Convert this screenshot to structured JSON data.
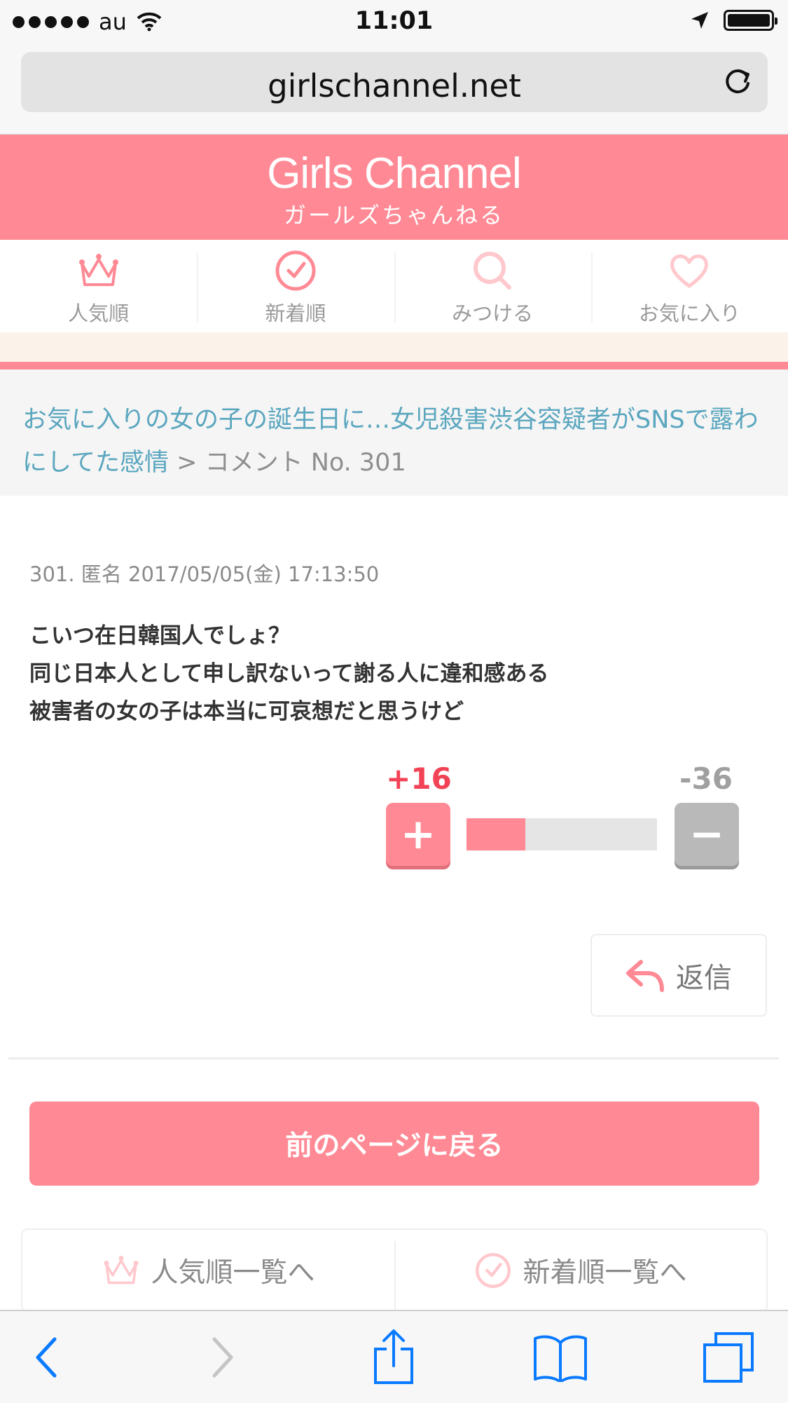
{
  "status_bar": {
    "carrier": "au",
    "time": "11:01"
  },
  "browser": {
    "url": "girlschannel.net"
  },
  "header": {
    "title_en": "Girls Channel",
    "title_jp": "ガールズちゃんねる"
  },
  "nav": {
    "items": [
      {
        "label": "人気順",
        "icon": "crown-icon"
      },
      {
        "label": "新着順",
        "icon": "clock-icon"
      },
      {
        "label": "みつける",
        "icon": "search-icon"
      },
      {
        "label": "お気に入り",
        "icon": "heart-icon"
      }
    ]
  },
  "breadcrumb": {
    "topic": "お気に入りの女の子の誕生日に…女児殺害渋谷容疑者がSNSで露わにしてた感情",
    "separator": ">",
    "current": "コメント No. 301"
  },
  "comment": {
    "meta": "301. 匿名 2017/05/05(金) 17:13:50",
    "lines": [
      "こいつ在日韓国人でしょ？",
      "同じ日本人として申し訳ないって謝る人に違和感ある",
      "被害者の女の子は本当に可哀想だと思うけど"
    ],
    "plus_count": "+16",
    "minus_count": "-36",
    "plus_label": "+",
    "minus_label": "−",
    "plus_ratio": 0.31,
    "reply_label": "返信"
  },
  "back_button": "前のページに戻る",
  "list_links": [
    {
      "label": "人気順一覧へ",
      "icon": "crown-icon"
    },
    {
      "label": "新着順一覧へ",
      "icon": "clock-icon"
    }
  ],
  "colors": {
    "brand_pink": "#ff8a95",
    "link_blue": "#5aa6bf",
    "plus_red": "#f24255",
    "ios_blue": "#0a7aff"
  }
}
